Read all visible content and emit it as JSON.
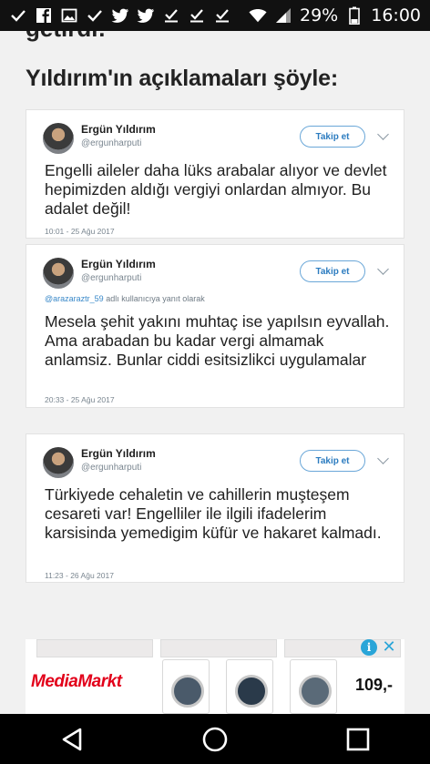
{
  "status_bar": {
    "left_icons": [
      "check-icon",
      "facebook-icon",
      "image-icon",
      "check-icon",
      "twitter-icon",
      "twitter-icon",
      "download-done-icon",
      "download-done-icon",
      "download-done-icon"
    ],
    "battery": "29%",
    "time": "16:00"
  },
  "article": {
    "cut_text": "getirdi:",
    "heading": "Yıldırım'ın açıklamaları şöyle:"
  },
  "tweets": [
    {
      "name": "Ergün Yıldırım",
      "handle": "@ergunharputi",
      "follow": "Takip et",
      "reply_mention": "",
      "reply_suffix": "",
      "body": "Engelli aileler daha lüks arabalar alıyor ve devlet hepimizden aldığı vergiyi onlardan almıyor. Bu adalet değil!",
      "time": "10:01 - 25 Ağu 2017"
    },
    {
      "name": "Ergün Yıldırım",
      "handle": "@ergunharputi",
      "follow": "Takip et",
      "reply_mention": "@arazaraztr_59",
      "reply_suffix": "adlı kullanıcıya yanıt olarak",
      "body": "Mesela şehit yakını muhtaç ise yapılsın eyvallah. Ama arabadan bu kadar vergi almamak anlamsiz. Bunlar ciddi esitsizlikci uygulamalar",
      "time": "20:33 - 25 Ağu 2017"
    },
    {
      "name": "Ergün Yıldırım",
      "handle": "@ergunharputi",
      "follow": "Takip et",
      "reply_mention": "",
      "reply_suffix": "",
      "body": "Türkiyede cehaletin ve cahillerin muşteşem cesareti var! Engelliler ile ilgili ifadelerim karsisinda yemedigim küfür ve hakaret kalmadı.",
      "time": "11:23 - 26 Ağu 2017"
    }
  ],
  "ad": {
    "brand": "MediaMarkt",
    "price": "109,-",
    "info": "i",
    "close": "✕"
  },
  "colors": {
    "follow_border": "#6aa7d8",
    "mention": "#3a89c9",
    "brand_red": "#e2001a"
  }
}
